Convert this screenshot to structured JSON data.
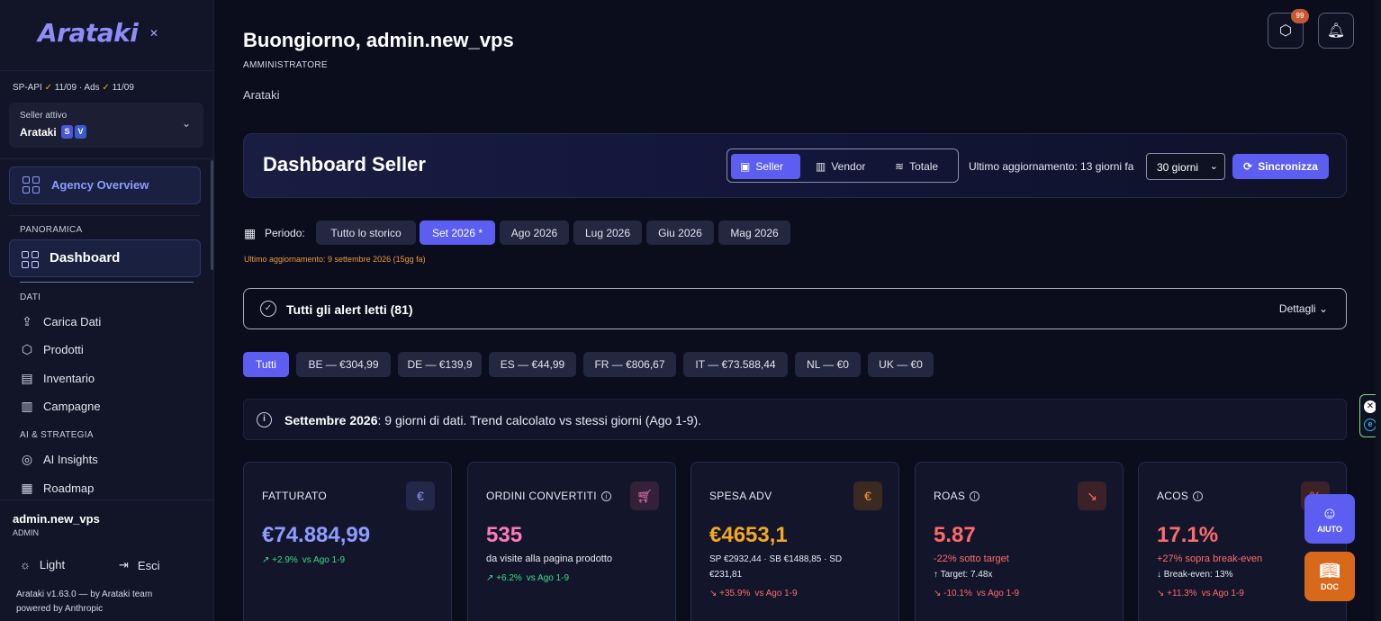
{
  "sidebar": {
    "logo": "Arataki",
    "api_status": {
      "sp_api": "SP-API",
      "sp_date": "11/09",
      "ads": "Ads",
      "ads_date": "11/09",
      "check": "✓",
      "dot": "·"
    },
    "seller": {
      "label": "Seller attivo",
      "name": "Arataki",
      "tag_s": "S",
      "tag_v": "V"
    },
    "agency_overview": "Agency Overview",
    "sections": {
      "panoramica": "PANORAMICA",
      "dati": "DATI",
      "ai": "AI & STRATEGIA"
    },
    "dashboard": "Dashboard",
    "items": [
      {
        "label": "Carica Dati",
        "icon": "upload-icon"
      },
      {
        "label": "Prodotti",
        "icon": "box-icon"
      },
      {
        "label": "Inventario",
        "icon": "archive-icon"
      },
      {
        "label": "Campagne",
        "icon": "bar-chart-icon"
      },
      {
        "label": "AI Insights",
        "icon": "globe-icon"
      },
      {
        "label": "Roadmap",
        "icon": "calendar-icon"
      }
    ],
    "user": {
      "name": "admin.new_vps",
      "role": "ADMIN"
    },
    "light": "Light",
    "logout": "Esci",
    "version": "Arataki v1.63.0 — by Arataki team",
    "powered": "powered by Anthropic"
  },
  "header": {
    "greeting": "Buongiorno, admin.new_vps",
    "role": "AMMINISTRATORE",
    "company": "Arataki",
    "badge_count": "99"
  },
  "dashboard": {
    "title": "Dashboard Seller",
    "segments": [
      "Seller",
      "Vendor",
      "Totale"
    ],
    "last_update": "Ultimo aggiornamento: 13 giorni fa",
    "range_select": "30 giorni",
    "sync": "Sincronizza"
  },
  "periodo": {
    "label": "Periodo:",
    "options": [
      "Tutto lo storico",
      "Set 2026 *",
      "Ago 2026",
      "Lug 2026",
      "Giu 2026",
      "Mag 2026"
    ],
    "note": "Ultimo aggiornamento: 9 settembre 2026 (15gg fa)"
  },
  "alert": {
    "text": "Tutti gli alert letti (81)",
    "details": "Dettagli"
  },
  "marketplaces": [
    "Tutti",
    "BE — €304,99",
    "DE — €139,9",
    "ES — €44,99",
    "FR — €806,67",
    "IT — €73.588,44",
    "NL — €0",
    "UK — €0"
  ],
  "info": {
    "bold": "Settembre 2026",
    "rest": ": 9 giorni di dati. Trend calcolato vs stessi giorni (Ago 1-9)."
  },
  "kpis": [
    {
      "label": "FATTURATO",
      "value": "€74.884,99",
      "sub1": "",
      "sub2": "",
      "trend": "↗ +2.9%",
      "vs": "vs Ago 1-9",
      "icon": "€"
    },
    {
      "label": "ORDINI CONVERTITI",
      "value": "535",
      "sub1": "da visite alla pagina prodotto",
      "sub2": "",
      "trend": "↗ +6.2%",
      "vs": "vs Ago 1-9",
      "icon": "🛒"
    },
    {
      "label": "SPESA ADV",
      "value": "€4653,1",
      "sub1": "SP €2932,44 · SB €1488,85 · SD",
      "sub2": "€231,81",
      "trend": "↘ +35.9%",
      "vs": "vs Ago 1-9",
      "icon": "€"
    },
    {
      "label": "ROAS",
      "value": "5.87",
      "sub1": "-22% sotto target",
      "sub2": "↑ Target: 7.48x",
      "trend": "↘ -10.1%",
      "vs": "vs Ago 1-9",
      "icon": "↘"
    },
    {
      "label": "ACOS",
      "value": "17.1%",
      "sub1": "+27% sopra break-even",
      "sub2": "↓ Break-even: 13%",
      "trend": "↘ +11.3%",
      "vs": "vs Ago 1-9",
      "icon": "%"
    }
  ],
  "float": {
    "aiuto": "AIUTO",
    "doc": "DOC"
  },
  "colors": {
    "accent": "#5b5ef0",
    "green": "#3ddc84",
    "red": "#ff6b6b",
    "orange": "#f5a623",
    "pink": "#ff7ab8",
    "purple": "#8f9bff"
  }
}
